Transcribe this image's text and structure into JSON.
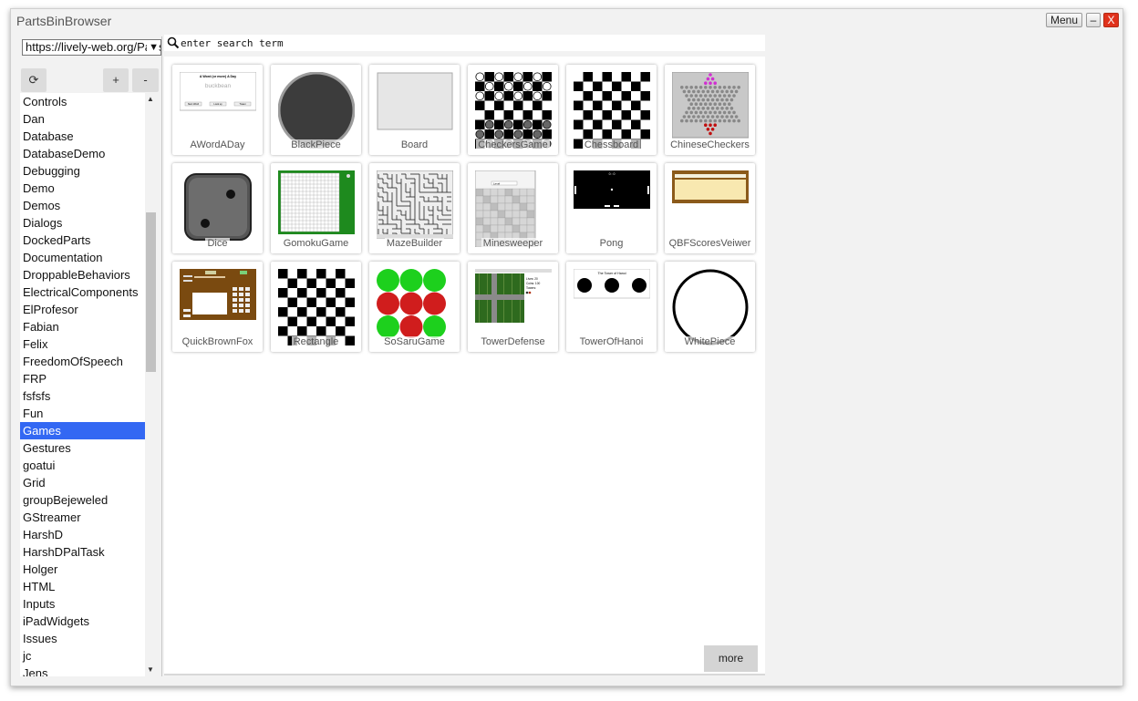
{
  "window": {
    "title": "PartsBinBrowser",
    "menu_label": "Menu",
    "minimize_label": "–",
    "close_label": "X"
  },
  "url_select": {
    "value": "https://lively-web.org/PartsBin/"
  },
  "toolbar": {
    "refresh": "⟳",
    "add": "+",
    "remove": "-"
  },
  "categories": [
    "Controls",
    "Dan",
    "Database",
    "DatabaseDemo",
    "Debugging",
    "Demo",
    "Demos",
    "Dialogs",
    "DockedParts",
    "Documentation",
    "DroppableBehaviors",
    "ElectricalComponents",
    "ElProfesor",
    "Fabian",
    "Felix",
    "FreedomOfSpeech",
    "FRP",
    "fsfsfs",
    "Fun",
    "Games",
    "Gestures",
    "goatui",
    "Grid",
    "groupBejeweled",
    "GStreamer",
    "HarshD",
    "HarshDPalTask",
    "Holger",
    "HTML",
    "Inputs",
    "iPadWidgets",
    "Issues",
    "jc",
    "Jens"
  ],
  "selected_category": "Games",
  "search": {
    "placeholder": "enter search term"
  },
  "parts": [
    {
      "name": "AWordADay",
      "thumb": "aword"
    },
    {
      "name": "BlackPiece",
      "thumb": "blackpiece"
    },
    {
      "name": "Board",
      "thumb": "board"
    },
    {
      "name": "CheckersGame",
      "thumb": "checkers"
    },
    {
      "name": "Chessboard",
      "thumb": "chessboard"
    },
    {
      "name": "ChineseCheckers",
      "thumb": "chinese"
    },
    {
      "name": "Dice",
      "thumb": "dice"
    },
    {
      "name": "GomokuGame",
      "thumb": "gomoku"
    },
    {
      "name": "MazeBuilder",
      "thumb": "maze"
    },
    {
      "name": "Minesweeper",
      "thumb": "mines"
    },
    {
      "name": "Pong",
      "thumb": "pong"
    },
    {
      "name": "QBFScoresVeiwer",
      "thumb": "qbf"
    },
    {
      "name": "QuickBrownFox",
      "thumb": "qbfox"
    },
    {
      "name": "Rectangle",
      "thumb": "rectangle"
    },
    {
      "name": "SoSaruGame",
      "thumb": "sosaru"
    },
    {
      "name": "TowerDefense",
      "thumb": "tower"
    },
    {
      "name": "TowerOfHanoi",
      "thumb": "hanoi"
    },
    {
      "name": "WhitePiece",
      "thumb": "whitepiece"
    }
  ],
  "thumb_text": {
    "aword": {
      "heading": "A Word (or more) A Day",
      "word": "buckbean",
      "buttons": [
        "Next Word",
        "Look up",
        "Tweet"
      ]
    },
    "minesweeper": {
      "level": "Level"
    },
    "pong": {
      "score": "0 : 0"
    },
    "hanoi": {
      "title": "The Tower of Hanoi"
    },
    "tower": {
      "stats": [
        "Lives: 20",
        "Coins: 100",
        "Towers:"
      ]
    }
  },
  "more_label": "more"
}
